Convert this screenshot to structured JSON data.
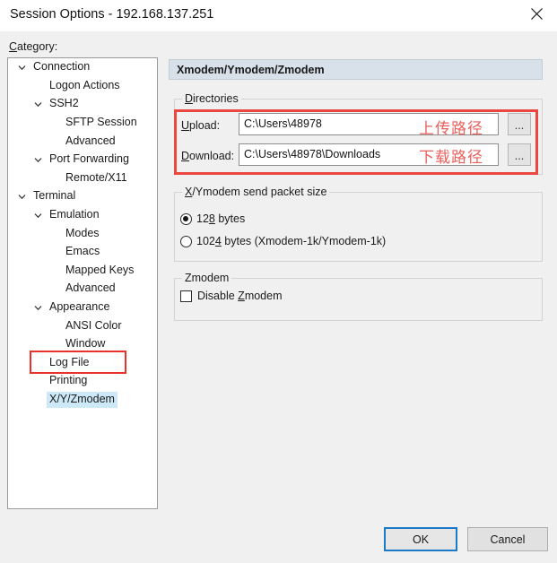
{
  "window": {
    "title": "Session Options - 192.168.137.251",
    "close_icon": "close-icon"
  },
  "category": {
    "label": "Category:",
    "tree": [
      {
        "label": "Connection",
        "indent": 0,
        "chevron": "chevron-down-icon",
        "selected": false
      },
      {
        "label": "Logon Actions",
        "indent": 1,
        "chevron": "",
        "selected": false
      },
      {
        "label": "SSH2",
        "indent": 1,
        "chevron": "chevron-down-icon",
        "selected": false
      },
      {
        "label": "SFTP Session",
        "indent": 2,
        "chevron": "",
        "selected": false
      },
      {
        "label": "Advanced",
        "indent": 2,
        "chevron": "",
        "selected": false
      },
      {
        "label": "Port Forwarding",
        "indent": 1,
        "chevron": "chevron-down-icon",
        "selected": false
      },
      {
        "label": "Remote/X11",
        "indent": 2,
        "chevron": "",
        "selected": false
      },
      {
        "label": "Terminal",
        "indent": 0,
        "chevron": "chevron-down-icon",
        "selected": false
      },
      {
        "label": "Emulation",
        "indent": 1,
        "chevron": "chevron-down-icon",
        "selected": false
      },
      {
        "label": "Modes",
        "indent": 2,
        "chevron": "",
        "selected": false
      },
      {
        "label": "Emacs",
        "indent": 2,
        "chevron": "",
        "selected": false
      },
      {
        "label": "Mapped Keys",
        "indent": 2,
        "chevron": "",
        "selected": false
      },
      {
        "label": "Advanced",
        "indent": 2,
        "chevron": "",
        "selected": false
      },
      {
        "label": "Appearance",
        "indent": 1,
        "chevron": "chevron-down-icon",
        "selected": false
      },
      {
        "label": "ANSI Color",
        "indent": 2,
        "chevron": "",
        "selected": false
      },
      {
        "label": "Window",
        "indent": 2,
        "chevron": "",
        "selected": false
      },
      {
        "label": "Log File",
        "indent": 1,
        "chevron": "",
        "selected": false
      },
      {
        "label": "Printing",
        "indent": 1,
        "chevron": "",
        "selected": false
      },
      {
        "label": "X/Y/Zmodem",
        "indent": 1,
        "chevron": "",
        "selected": true
      }
    ]
  },
  "pane": {
    "header": "Xmodem/Ymodem/Zmodem",
    "directories": {
      "legend_prefix": "D",
      "legend_rest": "irectories",
      "upload": {
        "label_prefix": "U",
        "label_rest": "pload:",
        "value": "C:\\Users\\48978",
        "browse_label": "...",
        "annotation_cn": "上传路径"
      },
      "download": {
        "label_prefix": "D",
        "label_rest": "ownload:",
        "value": "C:\\Users\\48978\\Downloads",
        "browse_label": "...",
        "annotation_cn": "下载路径"
      }
    },
    "packet_size": {
      "legend_prefix": "X",
      "legend_rest": "/Ymodem send packet size",
      "options": [
        {
          "pre": "12",
          "accel": "8",
          "post": " bytes",
          "selected": true
        },
        {
          "pre": "102",
          "accel": "4",
          "post": " bytes  (Xmodem-1k/Ymodem-1k)",
          "selected": false
        }
      ]
    },
    "zmodem": {
      "legend": "Zmodem",
      "checkbox": {
        "pre": "Disable ",
        "accel": "Z",
        "post": "modem",
        "checked": false
      }
    }
  },
  "footer": {
    "ok_label": "OK",
    "cancel_label": "Cancel"
  },
  "colors": {
    "dialog_bg": "#f0f0f0",
    "pane_header_bg": "#d8e0e9",
    "selection_bg": "#cde8f6",
    "annotation_red": "#ea4740",
    "annotation_text_red": "#e8605c",
    "default_button_border": "#1a7ac7"
  }
}
